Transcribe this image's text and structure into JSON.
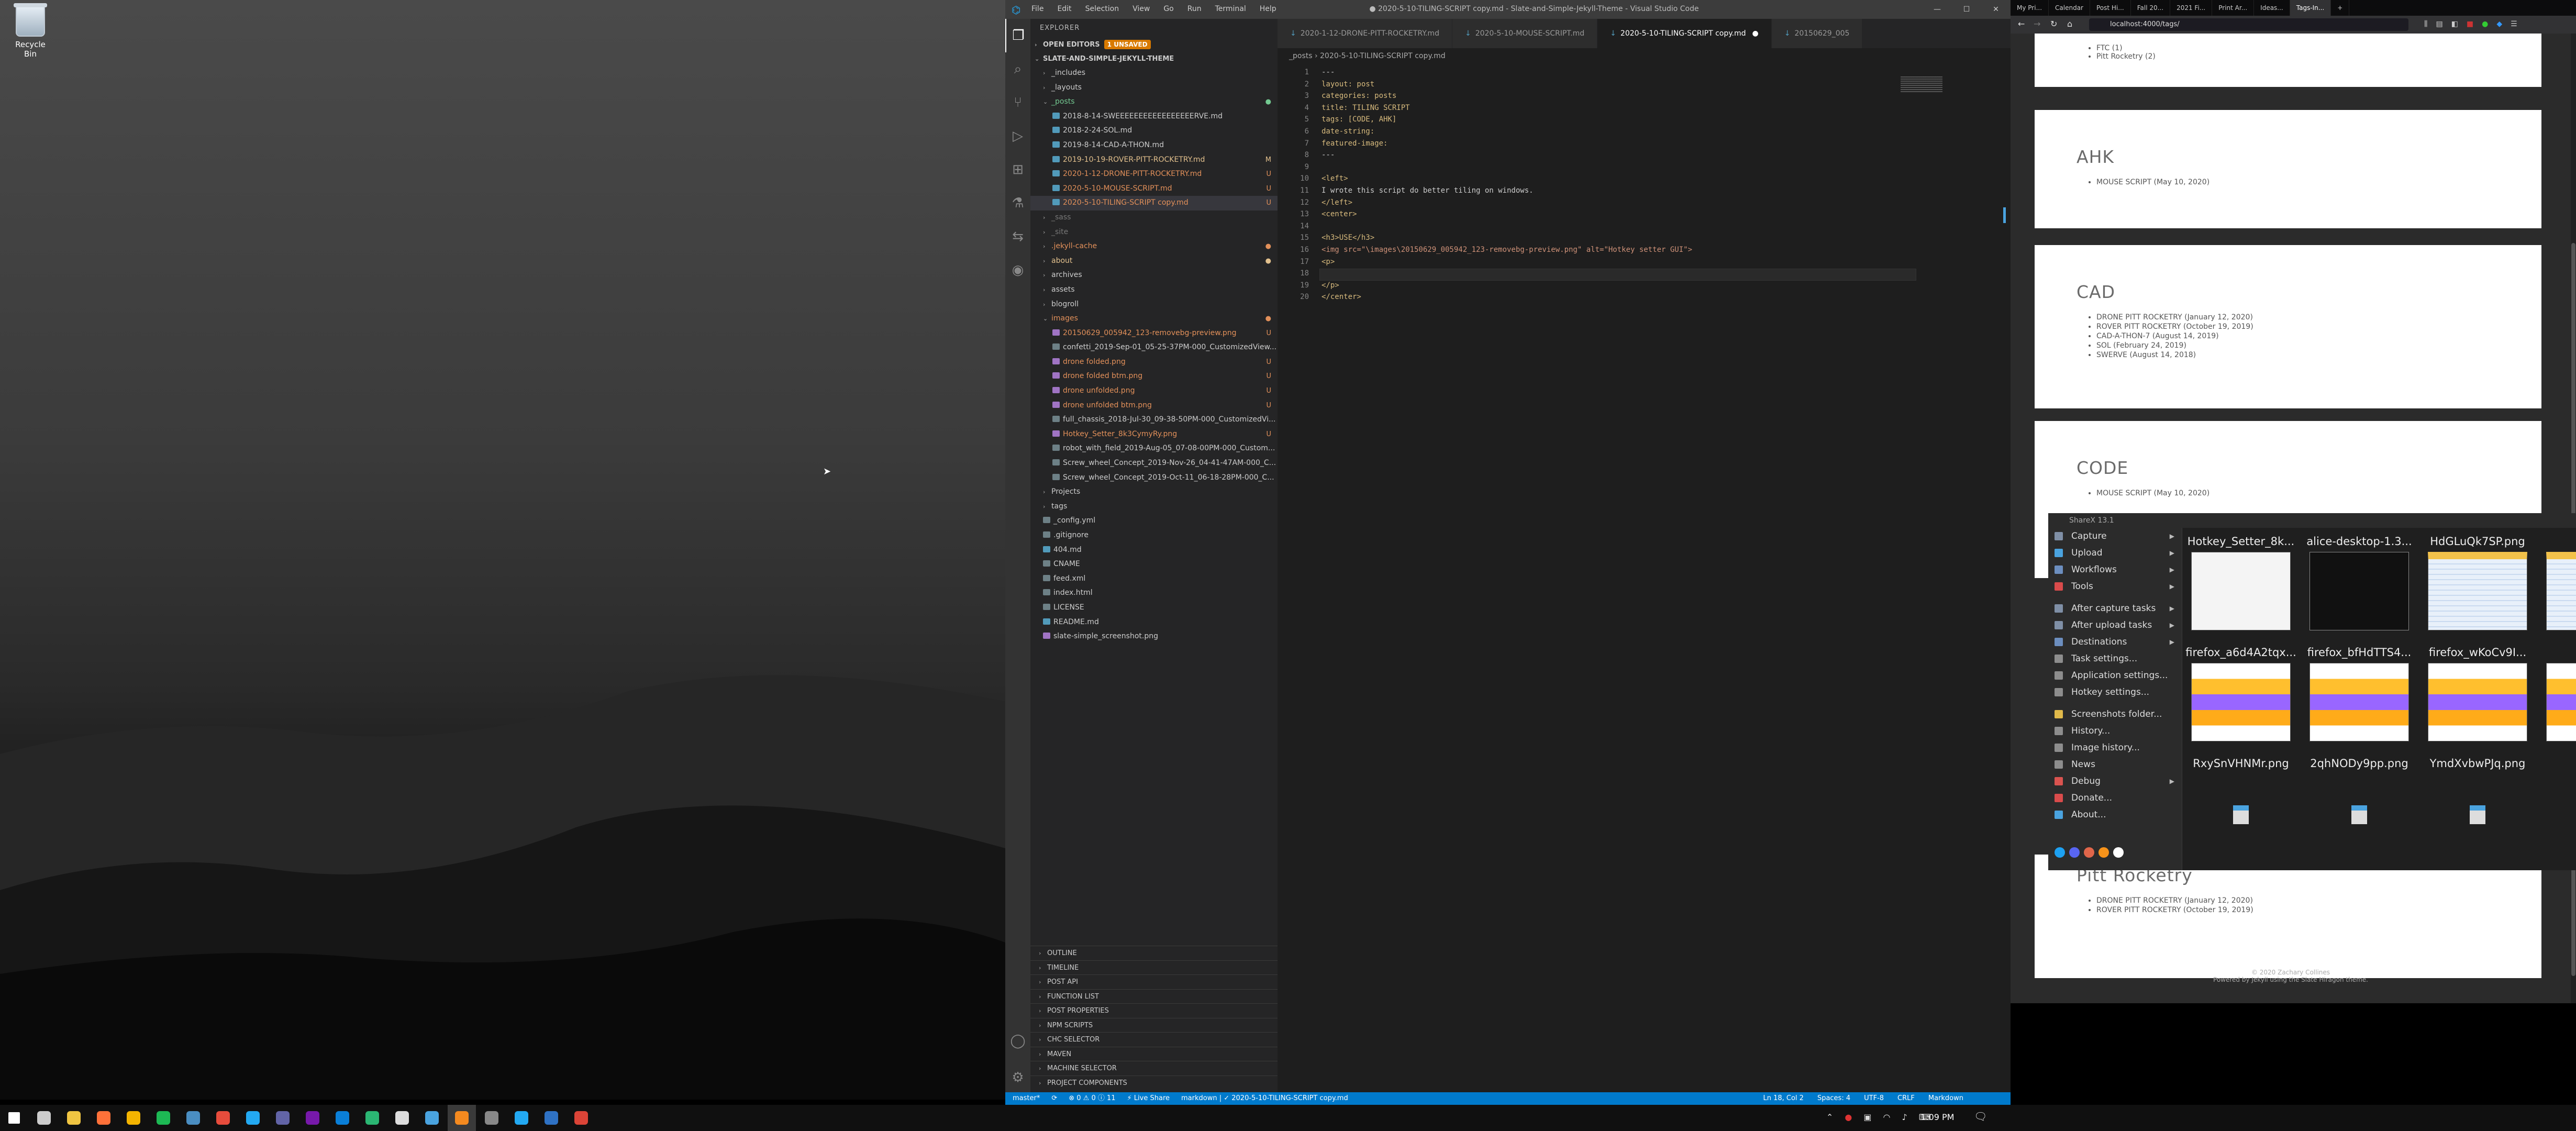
{
  "desktop": {
    "recycle_bin": "Recycle Bin"
  },
  "vscode": {
    "menu": [
      "File",
      "Edit",
      "Selection",
      "View",
      "Go",
      "Run",
      "Terminal",
      "Help"
    ],
    "window_title": "● 2020-5-10-TILING-SCRIPT copy.md - Slate-and-Simple-Jekyll-Theme - Visual Studio Code",
    "explorer_title": "EXPLORER",
    "open_editors": "OPEN EDITORS",
    "unsaved": "1 UNSAVED",
    "workspace": "SLATE-AND-SIMPLE-JEKYLL-THEME",
    "tree": [
      {
        "name": "_includes",
        "type": "folder",
        "depth": 0,
        "open": false,
        "status": "",
        "color": "#cccccc"
      },
      {
        "name": "_layouts",
        "type": "folder",
        "depth": 0,
        "open": false,
        "status": "",
        "color": "#cccccc"
      },
      {
        "name": "_posts",
        "type": "folder",
        "depth": 0,
        "open": true,
        "status": "●",
        "color": "#73c991"
      },
      {
        "name": "2018-8-14-SWEEEEEEEEEEEEEEEEERVE.md",
        "type": "file",
        "depth": 1,
        "status": "",
        "color": "#cccccc"
      },
      {
        "name": "2018-2-24-SOL.md",
        "type": "file",
        "depth": 1,
        "status": "",
        "color": "#cccccc"
      },
      {
        "name": "2019-8-14-CAD-A-THON.md",
        "type": "file",
        "depth": 1,
        "status": "",
        "color": "#cccccc"
      },
      {
        "name": "2019-10-19-ROVER-PITT-ROCKETRY.md",
        "type": "file",
        "depth": 1,
        "status": "M",
        "color": "#e2c08d"
      },
      {
        "name": "2020-1-12-DRONE-PITT-ROCKETRY.md",
        "type": "file",
        "depth": 1,
        "status": "U",
        "color": "#e2905a"
      },
      {
        "name": "2020-5-10-MOUSE-SCRIPT.md",
        "type": "file",
        "depth": 1,
        "status": "U",
        "color": "#e2905a"
      },
      {
        "name": "2020-5-10-TILING-SCRIPT copy.md",
        "type": "file",
        "depth": 1,
        "status": "U",
        "color": "#e2905a",
        "selected": true
      },
      {
        "name": "_sass",
        "type": "folder",
        "depth": 0,
        "open": false,
        "status": "",
        "color": "#777777"
      },
      {
        "name": "_site",
        "type": "folder",
        "depth": 0,
        "open": false,
        "status": "",
        "color": "#777777"
      },
      {
        "name": ".jekyll-cache",
        "type": "folder",
        "depth": 0,
        "open": false,
        "status": "●",
        "color": "#e2905a"
      },
      {
        "name": "about",
        "type": "folder",
        "depth": 0,
        "open": false,
        "status": "●",
        "color": "#e2c08d"
      },
      {
        "name": "archives",
        "type": "folder",
        "depth": 0,
        "open": false,
        "status": "",
        "color": "#cccccc"
      },
      {
        "name": "assets",
        "type": "folder",
        "depth": 0,
        "open": false,
        "status": "",
        "color": "#cccccc"
      },
      {
        "name": "blogroll",
        "type": "folder",
        "depth": 0,
        "open": false,
        "status": "",
        "color": "#cccccc"
      },
      {
        "name": "images",
        "type": "folder",
        "depth": 0,
        "open": true,
        "status": "●",
        "color": "#e2905a"
      },
      {
        "name": "20150629_005942_123-removebg-preview.png",
        "type": "file",
        "depth": 1,
        "status": "U",
        "color": "#e2905a"
      },
      {
        "name": "confetti_2019-Sep-01_05-25-37PM-000_CustomizedView...",
        "type": "file",
        "depth": 1,
        "status": "",
        "color": "#cccccc"
      },
      {
        "name": "drone folded.png",
        "type": "file",
        "depth": 1,
        "status": "U",
        "color": "#e2905a"
      },
      {
        "name": "drone folded btm.png",
        "type": "file",
        "depth": 1,
        "status": "U",
        "color": "#e2905a"
      },
      {
        "name": "drone unfolded.png",
        "type": "file",
        "depth": 1,
        "status": "U",
        "color": "#e2905a"
      },
      {
        "name": "drone unfolded btm.png",
        "type": "file",
        "depth": 1,
        "status": "U",
        "color": "#e2905a"
      },
      {
        "name": "full_chassis_2018-Jul-30_09-38-50PM-000_CustomizedVi...",
        "type": "file",
        "depth": 1,
        "status": "",
        "color": "#cccccc"
      },
      {
        "name": "Hotkey_Setter_8k3CymyRy.png",
        "type": "file",
        "depth": 1,
        "status": "U",
        "color": "#e2905a"
      },
      {
        "name": "robot_with_field_2019-Aug-05_07-08-00PM-000_Custom...",
        "type": "file",
        "depth": 1,
        "status": "",
        "color": "#cccccc"
      },
      {
        "name": "Screw_wheel_Concept_2019-Nov-26_04-41-47AM-000_C...",
        "type": "file",
        "depth": 1,
        "status": "",
        "color": "#cccccc"
      },
      {
        "name": "Screw_wheel_Concept_2019-Oct-11_06-18-28PM-000_C...",
        "type": "file",
        "depth": 1,
        "status": "",
        "color": "#cccccc"
      },
      {
        "name": "Projects",
        "type": "folder",
        "depth": 0,
        "open": false,
        "status": "",
        "color": "#cccccc"
      },
      {
        "name": "tags",
        "type": "folder",
        "depth": 0,
        "open": false,
        "status": "",
        "color": "#cccccc"
      },
      {
        "name": "_config.yml",
        "type": "file",
        "depth": 0,
        "status": "",
        "color": "#cccccc"
      },
      {
        "name": ".gitignore",
        "type": "file",
        "depth": 0,
        "status": "",
        "color": "#cccccc"
      },
      {
        "name": "404.md",
        "type": "file",
        "depth": 0,
        "status": "",
        "color": "#cccccc"
      },
      {
        "name": "CNAME",
        "type": "file",
        "depth": 0,
        "status": "",
        "color": "#cccccc"
      },
      {
        "name": "feed.xml",
        "type": "file",
        "depth": 0,
        "status": "",
        "color": "#cccccc"
      },
      {
        "name": "index.html",
        "type": "file",
        "depth": 0,
        "status": "",
        "color": "#cccccc"
      },
      {
        "name": "LICENSE",
        "type": "file",
        "depth": 0,
        "status": "",
        "color": "#cccccc"
      },
      {
        "name": "README.md",
        "type": "file",
        "depth": 0,
        "status": "",
        "color": "#cccccc"
      },
      {
        "name": "slate-simple_screenshot.png",
        "type": "file",
        "depth": 0,
        "status": "",
        "color": "#cccccc"
      }
    ],
    "outline_sections": [
      "OUTLINE",
      "TIMELINE",
      "POST API",
      "FUNCTION LIST",
      "POST PROPERTIES",
      "NPM SCRIPTS",
      "CHC SELECTOR",
      "MAVEN",
      "MACHINE SELECTOR",
      "PROJECT COMPONENTS"
    ],
    "tabs": [
      "2020-1-12-DRONE-PITT-ROCKETRY.md",
      "2020-5-10-MOUSE-SCRIPT.md",
      "2020-5-10-TILING-SCRIPT copy.md",
      "20150629_005"
    ],
    "active_tab": 2,
    "breadcrumb": "_posts  ›  2020-5-10-TILING-SCRIPT copy.md",
    "code": [
      {
        "n": "1",
        "t": "---",
        "c": "#cccccc"
      },
      {
        "n": "2",
        "t": "layout: post",
        "c": "#d7ba7d"
      },
      {
        "n": "3",
        "t": "categories: posts",
        "c": "#d7ba7d"
      },
      {
        "n": "4",
        "t": "title: TILING SCRIPT",
        "c": "#d7ba7d"
      },
      {
        "n": "5",
        "t": "tags: [CODE, AHK]",
        "c": "#d7ba7d"
      },
      {
        "n": "6",
        "t": "date-string:",
        "c": "#d7ba7d"
      },
      {
        "n": "7",
        "t": "featured-image:",
        "c": "#d7ba7d"
      },
      {
        "n": "8",
        "t": "---",
        "c": "#cccccc"
      },
      {
        "n": "9",
        "t": "",
        "c": "#cccccc"
      },
      {
        "n": "10",
        "t": "<left>",
        "c": "#d7ba7d"
      },
      {
        "n": "11",
        "t": "I wrote this script do better tiling on windows.",
        "c": "#cccccc"
      },
      {
        "n": "12",
        "t": "</left>",
        "c": "#d7ba7d"
      },
      {
        "n": "13",
        "t": "<center>",
        "c": "#d7ba7d"
      },
      {
        "n": "14",
        "t": "",
        "c": "#cccccc"
      },
      {
        "n": "15",
        "t": "<h3>USE</h3>",
        "c": "#d7ba7d"
      },
      {
        "n": "16",
        "t": "<img src=\"\\images\\20150629_005942_123-removebg-preview.png\" alt=\"Hotkey setter GUI\">",
        "c": "#ce9178"
      },
      {
        "n": "17",
        "t": "<p>",
        "c": "#d7ba7d"
      },
      {
        "n": "18",
        "t": "",
        "c": "#cccccc"
      },
      {
        "n": "19",
        "t": "</p>",
        "c": "#d7ba7d"
      },
      {
        "n": "20",
        "t": "</center>",
        "c": "#d7ba7d"
      }
    ],
    "status_left": [
      "master*",
      "⟳",
      "⊗ 0  ⚠ 0  ⓘ 11",
      "⚡ Live Share",
      "markdown | ✓ 2020-5-10-TILING-SCRIPT copy.md"
    ],
    "status_right": [
      "Ln 18, Col 2",
      "Spaces: 4",
      "UTF-8",
      "CRLF",
      "Markdown"
    ]
  },
  "firefox": {
    "tabs": [
      "My Pri...",
      "Calendar",
      "Post Hi...",
      "Fall 20...",
      "2021 Fi...",
      "Print Ar...",
      "Ideas...",
      "Tags-In...",
      "+"
    ],
    "active_tab": 7,
    "url": "localhost:4000/tags/",
    "top_list": [
      "FTC (1)",
      "Pitt Rocketry (2)"
    ],
    "cards": [
      {
        "title": "AHK",
        "items": [
          "MOUSE SCRIPT (May 10, 2020)"
        ]
      },
      {
        "title": "CAD",
        "items": [
          "DRONE PITT ROCKETRY (January 12, 2020)",
          "ROVER PITT ROCKETRY (October 19, 2019)",
          "CAD-A-THON-7 (August 14, 2019)",
          "SOL (February 24, 2019)",
          "SWERVE (August 14, 2018)"
        ]
      },
      {
        "title": "CODE",
        "items": [
          "MOUSE SCRIPT (May 10, 2020)"
        ]
      },
      {
        "title": "Pitt Rocketry",
        "items": [
          "DRONE PITT ROCKETRY (January 12, 2020)",
          "ROVER PITT ROCKETRY (October 19, 2019)"
        ]
      }
    ],
    "footer1": "© 2020 Zachary Collines",
    "footer2": "Powered by Jekyll using the Slate Hiragon theme."
  },
  "sharex": {
    "title": "ShareX 13.1",
    "menu": [
      "Capture",
      "Upload",
      "Workflows",
      "Tools",
      "",
      "After capture tasks",
      "After upload tasks",
      "Destinations",
      "Task settings...",
      "Application settings...",
      "Hotkey settings...",
      "",
      "Screenshots folder...",
      "History...",
      "Image history...",
      "News",
      "Debug",
      "Donate...",
      "About..."
    ],
    "submenu": [
      true,
      true,
      true,
      true,
      false,
      true,
      true,
      true,
      false,
      false,
      false,
      false,
      false,
      false,
      false,
      false,
      true,
      false,
      false
    ],
    "icon_colors": [
      "#7f8fa6",
      "#4aa3df",
      "#6c8ebf",
      "#d94b4b",
      "",
      "#7f8fa6",
      "#7f8fa6",
      "#6c8ebf",
      "#8d8d8d",
      "#8d8d8d",
      "#8d8d8d",
      "",
      "#e0b94a",
      "#8d8d8d",
      "#8d8d8d",
      "#8d8d8d",
      "#d9534f",
      "#d94b4b",
      "#4aa3df"
    ],
    "social_colors": [
      "#1da1f2",
      "#5865f2",
      "#e0664a",
      "#f7931a",
      "#ffffff"
    ],
    "thumbs": [
      {
        "name": "Hotkey_Setter_8k...",
        "kind": "white"
      },
      {
        "name": "alice-desktop-1.3...",
        "kind": "dark"
      },
      {
        "name": "HdGLuQk7SP.png",
        "kind": "table"
      },
      {
        "name": "Zoom_",
        "kind": "table"
      },
      {
        "name": "firefox_a6d4A2tqx...",
        "kind": "scratch"
      },
      {
        "name": "firefox_bfHdTTS4...",
        "kind": "scratch"
      },
      {
        "name": "firefox_wKoCv9I...",
        "kind": "scratch"
      },
      {
        "name": "firefox_",
        "kind": "scratch"
      },
      {
        "name": "RxySnVHNMr.png",
        "kind": "file"
      },
      {
        "name": "2qhNODy9pp.png",
        "kind": "file"
      },
      {
        "name": "YmdXvbwPJq.png",
        "kind": "file"
      },
      {
        "name": "J7pd",
        "kind": "file"
      }
    ]
  },
  "taskbar": {
    "time": "1:09 PM",
    "apps": [
      {
        "name": "start",
        "color": "#ffffff"
      },
      {
        "name": "task-view",
        "color": "#cccccc"
      },
      {
        "name": "file-explorer",
        "color": "#f0c542"
      },
      {
        "name": "firefox",
        "color": "#ff7139"
      },
      {
        "name": "chrome-canary",
        "color": "#f4b400"
      },
      {
        "name": "spotify",
        "color": "#1db954"
      },
      {
        "name": "steam",
        "color": "#4a8ec2"
      },
      {
        "name": "sharex",
        "color": "#e74c3c"
      },
      {
        "name": "vscode",
        "color": "#23a9f2"
      },
      {
        "name": "teams",
        "color": "#6264a7"
      },
      {
        "name": "onenote",
        "color": "#7719aa"
      },
      {
        "name": "outlook",
        "color": "#0a7fd8"
      },
      {
        "name": "edge",
        "color": "#2bb673"
      },
      {
        "name": "github",
        "color": "#dddddd"
      },
      {
        "name": "notepad",
        "color": "#4aa3df"
      },
      {
        "name": "sharex-active",
        "color": "#f58a1f"
      },
      {
        "name": "terminal",
        "color": "#888888"
      },
      {
        "name": "vscode-2",
        "color": "#23a9f2"
      },
      {
        "name": "explorer-2",
        "color": "#2f72c4"
      },
      {
        "name": "chrome",
        "color": "#db4437"
      }
    ]
  }
}
